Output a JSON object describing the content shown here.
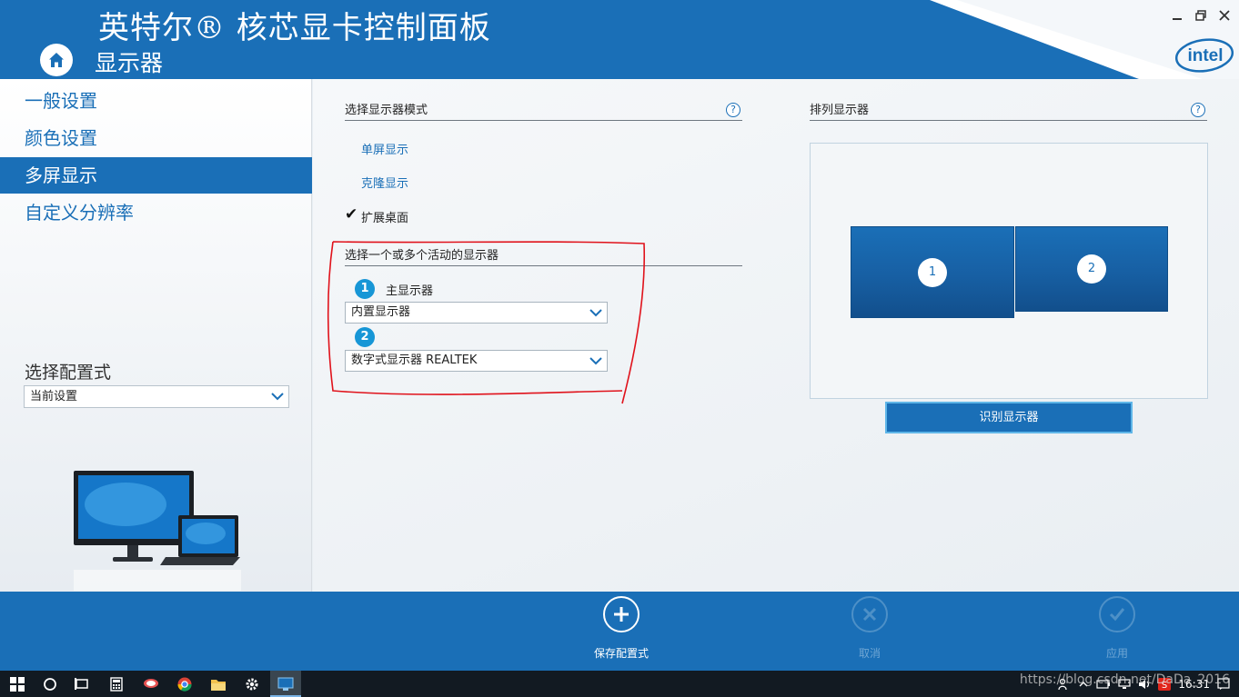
{
  "header": {
    "app_title": "英特尔® 核芯显卡控制面板",
    "page_title": "显示器",
    "brand": "intel"
  },
  "sidebar": {
    "items": [
      {
        "label": "一般设置",
        "active": false
      },
      {
        "label": "颜色设置",
        "active": false
      },
      {
        "label": "多屏显示",
        "active": true
      },
      {
        "label": "自定义分辨率",
        "active": false
      }
    ],
    "profile_label": "选择配置式",
    "profile_value": "当前设置"
  },
  "main": {
    "mode_section": {
      "title": "选择显示器模式",
      "help": "?",
      "options": [
        {
          "label": "单屏显示",
          "selected": false
        },
        {
          "label": "克隆显示",
          "selected": false
        },
        {
          "label": "扩展桌面",
          "selected": true
        }
      ],
      "check_glyph": "✔"
    },
    "active_section": {
      "title": "选择一个或多个活动的显示器",
      "primary_badge": "1",
      "primary_label": "主显示器",
      "primary_value": "内置显示器",
      "secondary_badge": "2",
      "secondary_value": "数字式显示器 REALTEK"
    },
    "arrange_section": {
      "title": "排列显示器",
      "help": "?",
      "monitors": [
        "1",
        "2"
      ],
      "identify_button": "识别显示器"
    }
  },
  "footer": {
    "save_label": "保存配置式",
    "cancel_label": "取消",
    "apply_label": "应用"
  },
  "taskbar": {
    "clock": "16:31",
    "watermark": "https://blog.csdn.net/DaDa_2016"
  },
  "colors": {
    "accent": "#1a6fb7",
    "badge": "#1796d6",
    "annotation": "#e0121b"
  }
}
